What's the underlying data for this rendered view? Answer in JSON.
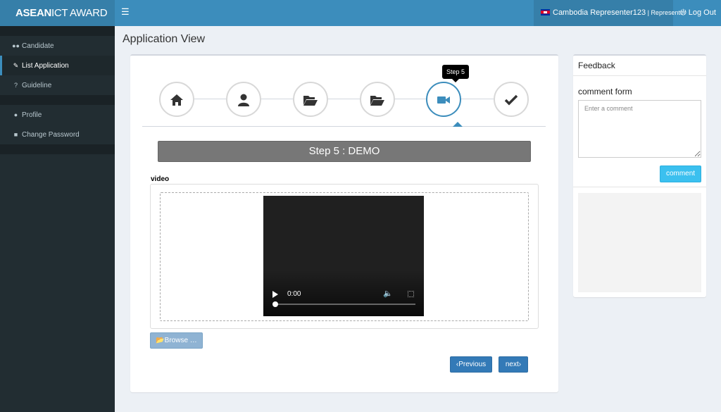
{
  "header": {
    "brand_bold": "ASEAN",
    "brand_rest": "ICT AWARD",
    "menu_toggle_icon": "bars-icon",
    "user_name": "Cambodia Representer123",
    "user_separator": " | ",
    "user_role": "Representer",
    "logout_label": "Log Out"
  },
  "sidebar": {
    "items": [
      {
        "label": "Candidate",
        "icon": "users-icon"
      },
      {
        "label": "List Application",
        "icon": "pencil-icon"
      },
      {
        "label": "Guideline",
        "icon": "question-icon"
      },
      {
        "label": "Profile",
        "icon": "user-icon"
      },
      {
        "label": "Change Password",
        "icon": "lock-icon"
      }
    ]
  },
  "page": {
    "title": "Application View"
  },
  "wizard": {
    "tooltip": "Step 5",
    "steps": [
      {
        "icon": "home-icon"
      },
      {
        "icon": "user-icon"
      },
      {
        "icon": "folder-open-icon"
      },
      {
        "icon": "folder-open-icon"
      },
      {
        "icon": "video-camera-icon"
      },
      {
        "icon": "check-icon"
      }
    ],
    "active_step": 5
  },
  "step_content": {
    "heading": "Step 5 : DEMO",
    "video_label": "video",
    "video_time": "0:00",
    "browse_label": "Browse …",
    "previous_label": "Previous",
    "next_label": "next"
  },
  "feedback": {
    "title": "Feedback",
    "form_title": "comment form",
    "placeholder": "Enter a comment",
    "button_label": "comment"
  },
  "colors": {
    "header": "#3c8dbc",
    "sidebar": "#222d32",
    "primary_button": "#337ab7",
    "info_button": "#3bc0ef",
    "step_heading": "#777777"
  }
}
